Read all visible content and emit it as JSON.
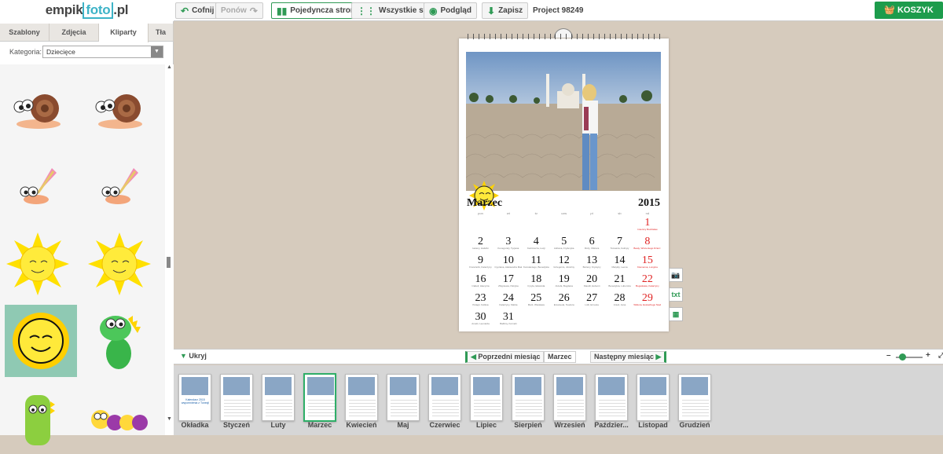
{
  "logo": {
    "part1": "empik",
    "part2": "foto",
    "part3": ".pl"
  },
  "left_tabs": [
    "Szablony",
    "Zdjęcia",
    "Kliparty",
    "Tła"
  ],
  "category": {
    "label": "Kategoria:",
    "value": "Dziecięce"
  },
  "clipart": [
    "snail",
    "snail",
    "shell-hermit",
    "shell-hermit",
    "sun",
    "sun",
    "smiling-sun",
    "dinosaur",
    "green-monster",
    "caterpillar"
  ],
  "toolbar": {
    "undo": "Cofnij",
    "redo": "Ponów",
    "single": "Pojedyncza strona",
    "all": "Wszystkie strony",
    "preview": "Podgląd",
    "save": "Zapisz",
    "project": "Project 98249",
    "cart": "KOSZYK"
  },
  "calendar": {
    "month": "Marzec",
    "year": "2015",
    "weekdays": [
      "pon",
      "wt",
      "śr",
      "czw",
      "pt",
      "sb",
      "nd"
    ],
    "weeks": [
      [
        {
          "d": "",
          "n": ""
        },
        {
          "d": "",
          "n": ""
        },
        {
          "d": "",
          "n": ""
        },
        {
          "d": "",
          "n": ""
        },
        {
          "d": "",
          "n": ""
        },
        {
          "d": "",
          "n": ""
        },
        {
          "d": "1",
          "n": "Imieniny Budzisław",
          "s": true
        }
      ],
      [
        {
          "d": "2",
          "n": "Heleny, Halszki"
        },
        {
          "d": "3",
          "n": "Kunegundy, Tycjana"
        },
        {
          "d": "4",
          "n": "Kazimierza, Łucji"
        },
        {
          "d": "5",
          "n": "Adriana, Fryderyka"
        },
        {
          "d": "6",
          "n": "Róży, Wiktora"
        },
        {
          "d": "7",
          "n": "Tomasza, Felicyty"
        },
        {
          "d": "8",
          "n": "Beaty, Wincentego Dzień Kobiet",
          "s": true
        }
      ],
      [
        {
          "d": "9",
          "n": "Franciszki, Katarzyny"
        },
        {
          "d": "10",
          "n": "Cypriana, Aleksandra Makarego"
        },
        {
          "d": "11",
          "n": "Konstantego, Benedykta"
        },
        {
          "d": "12",
          "n": "Grzegorza, Józefiny"
        },
        {
          "d": "13",
          "n": "Bożeny, Krystyny"
        },
        {
          "d": "14",
          "n": "Matyldy, Leona"
        },
        {
          "d": "15",
          "n": "Klemensa, Longina",
          "s": true
        }
      ],
      [
        {
          "d": "16",
          "n": "Izabeli, Hiacynta"
        },
        {
          "d": "17",
          "n": "Zbigniewa, Patryka"
        },
        {
          "d": "18",
          "n": "Cyryla, Edwarda"
        },
        {
          "d": "19",
          "n": "Józefa, Bogdana"
        },
        {
          "d": "20",
          "n": "Klaudii, Eufemii"
        },
        {
          "d": "21",
          "n": "Benedykta, Lubomira"
        },
        {
          "d": "22",
          "n": "Bogusława, Katarzyny",
          "s": true
        }
      ],
      [
        {
          "d": "23",
          "n": "Pelagii, Feliksa"
        },
        {
          "d": "24",
          "n": "Katarzyny, Marka"
        },
        {
          "d": "25",
          "n": "Marii, Wiesława"
        },
        {
          "d": "26",
          "n": "Emanuela, Teodora"
        },
        {
          "d": "27",
          "n": "Lidii, Ernesta"
        },
        {
          "d": "28",
          "n": "Anieli, Jana"
        },
        {
          "d": "29",
          "n": "Wiktora, Eustachego Niedziela Palmowa",
          "s": true
        }
      ],
      [
        {
          "d": "30",
          "n": "Amelii, Leonarda"
        },
        {
          "d": "31",
          "n": "Balbiny, Kornelii"
        },
        {
          "d": "",
          "n": ""
        },
        {
          "d": "",
          "n": ""
        },
        {
          "d": "",
          "n": ""
        },
        {
          "d": "",
          "n": ""
        },
        {
          "d": "",
          "n": ""
        }
      ]
    ]
  },
  "side_tools": [
    "camera",
    "txt",
    "calendar"
  ],
  "nav": {
    "hide": "Ukryj",
    "prev": "Poprzedni miesiąc",
    "current": "Marzec",
    "next": "Następny miesiąc"
  },
  "thumbs": [
    "Okładka",
    "Styczeń",
    "Luty",
    "Marzec",
    "Kwiecień",
    "Maj",
    "Czerwiec",
    "Lipiec",
    "Sierpień",
    "Wrzesień",
    "Październik",
    "Listopad",
    "Grudzień"
  ],
  "thumb_labels_shown": [
    "Okładka",
    "Styczeń",
    "Luty",
    "Marzec",
    "Kwiecień",
    "Maj",
    "Czerwiec",
    "Lipiec",
    "Sierpień",
    "Wrzesień",
    "Paździer...",
    "Listopad",
    "Grudzień"
  ],
  "cover_caption": "Kalendarz 2015 wspomnienia z Tunezji",
  "selected_thumb": 3,
  "colors": {
    "accent": "#1d9c4c",
    "selected": "#2fae68",
    "sunday": "#e02323"
  }
}
